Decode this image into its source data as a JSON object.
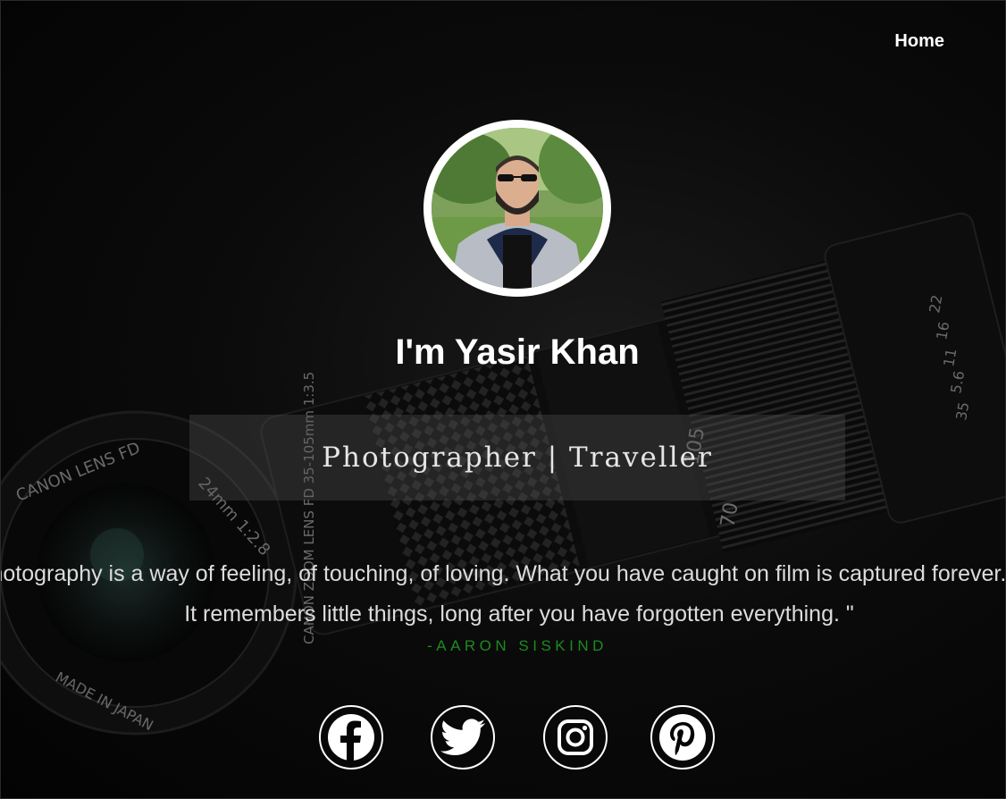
{
  "nav": {
    "home_label": "Home"
  },
  "profile": {
    "name": "I'm Yasir Khan",
    "role": "Photographer | Traveller"
  },
  "quote": {
    "line1": "\" Photography is a way of feeling, of touching, of loving. What you have caught on film is captured forever...",
    "line2": "It remembers little things, long after you have forgotten everything. \"",
    "author": "-AARON SISKIND"
  },
  "social": [
    {
      "name": "facebook",
      "icon": "facebook-icon"
    },
    {
      "name": "twitter",
      "icon": "twitter-icon"
    },
    {
      "name": "instagram",
      "icon": "instagram-icon"
    },
    {
      "name": "pinterest",
      "icon": "pinterest-icon"
    }
  ],
  "background": {
    "lens_text": [
      "CANON LENS FD",
      "24mm 1:2.8",
      "CANON ZOOM LENS FD 35-105mm 1:3.5",
      "MADE IN JAPAN",
      "105",
      "70",
      "35",
      "22",
      "16",
      "11",
      "5.6"
    ]
  },
  "colors": {
    "background": "#050505",
    "text": "#ffffff",
    "author": "#1f8a1f",
    "role_box": "rgba(90,90,90,0.32)"
  }
}
